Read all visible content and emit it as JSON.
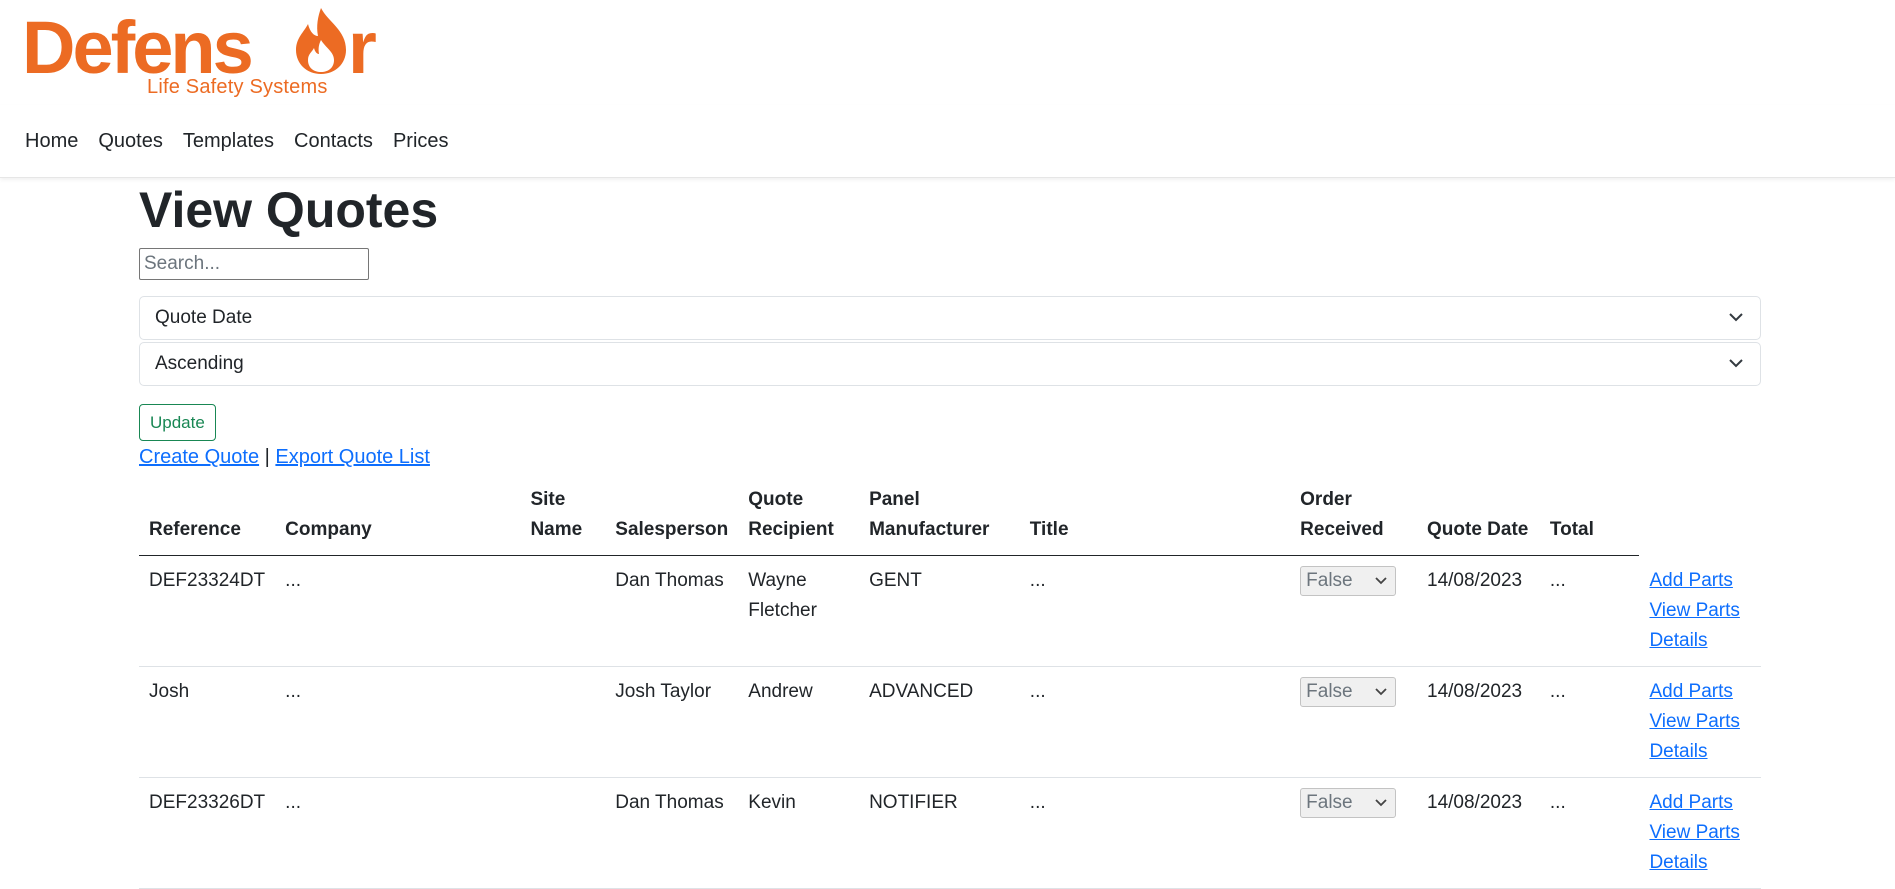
{
  "brand": {
    "name": "Defensor",
    "tagline": "Life Safety Systems",
    "color": "#ec6b23"
  },
  "nav": {
    "items": [
      "Home",
      "Quotes",
      "Templates",
      "Contacts",
      "Prices"
    ]
  },
  "page": {
    "title": "View Quotes",
    "search_placeholder": "Search...",
    "sort_field": "Quote Date",
    "sort_order": "Ascending",
    "update_label": "Update",
    "create_link": "Create Quote",
    "separator": "|",
    "export_link": "Export Quote List"
  },
  "table": {
    "headers": [
      "Reference",
      "Company",
      "Site Name",
      "Salesperson",
      "Quote Recipient",
      "Panel Manufacturer",
      "Title",
      "Order Received",
      "Quote Date",
      "Total"
    ],
    "actions": [
      "Add Parts",
      "View Parts",
      "Details"
    ],
    "rows": [
      {
        "reference": "DEF23324DT",
        "company": "...",
        "site_name": "",
        "salesperson": "Dan Thomas",
        "recipient": "Wayne Fletcher",
        "panel": "GENT",
        "title": "...",
        "order_received": "False",
        "quote_date": "14/08/2023",
        "total": "..."
      },
      {
        "reference": "Josh",
        "company": "...",
        "site_name": "",
        "salesperson": "Josh Taylor",
        "recipient": "Andrew",
        "panel": "ADVANCED",
        "title": "...",
        "order_received": "False",
        "quote_date": "14/08/2023",
        "total": "..."
      },
      {
        "reference": "DEF23326DT",
        "company": "...",
        "site_name": "",
        "salesperson": "Dan Thomas",
        "recipient": "Kevin",
        "panel": "NOTIFIER",
        "title": "...",
        "order_received": "False",
        "quote_date": "14/08/2023",
        "total": "..."
      }
    ]
  }
}
